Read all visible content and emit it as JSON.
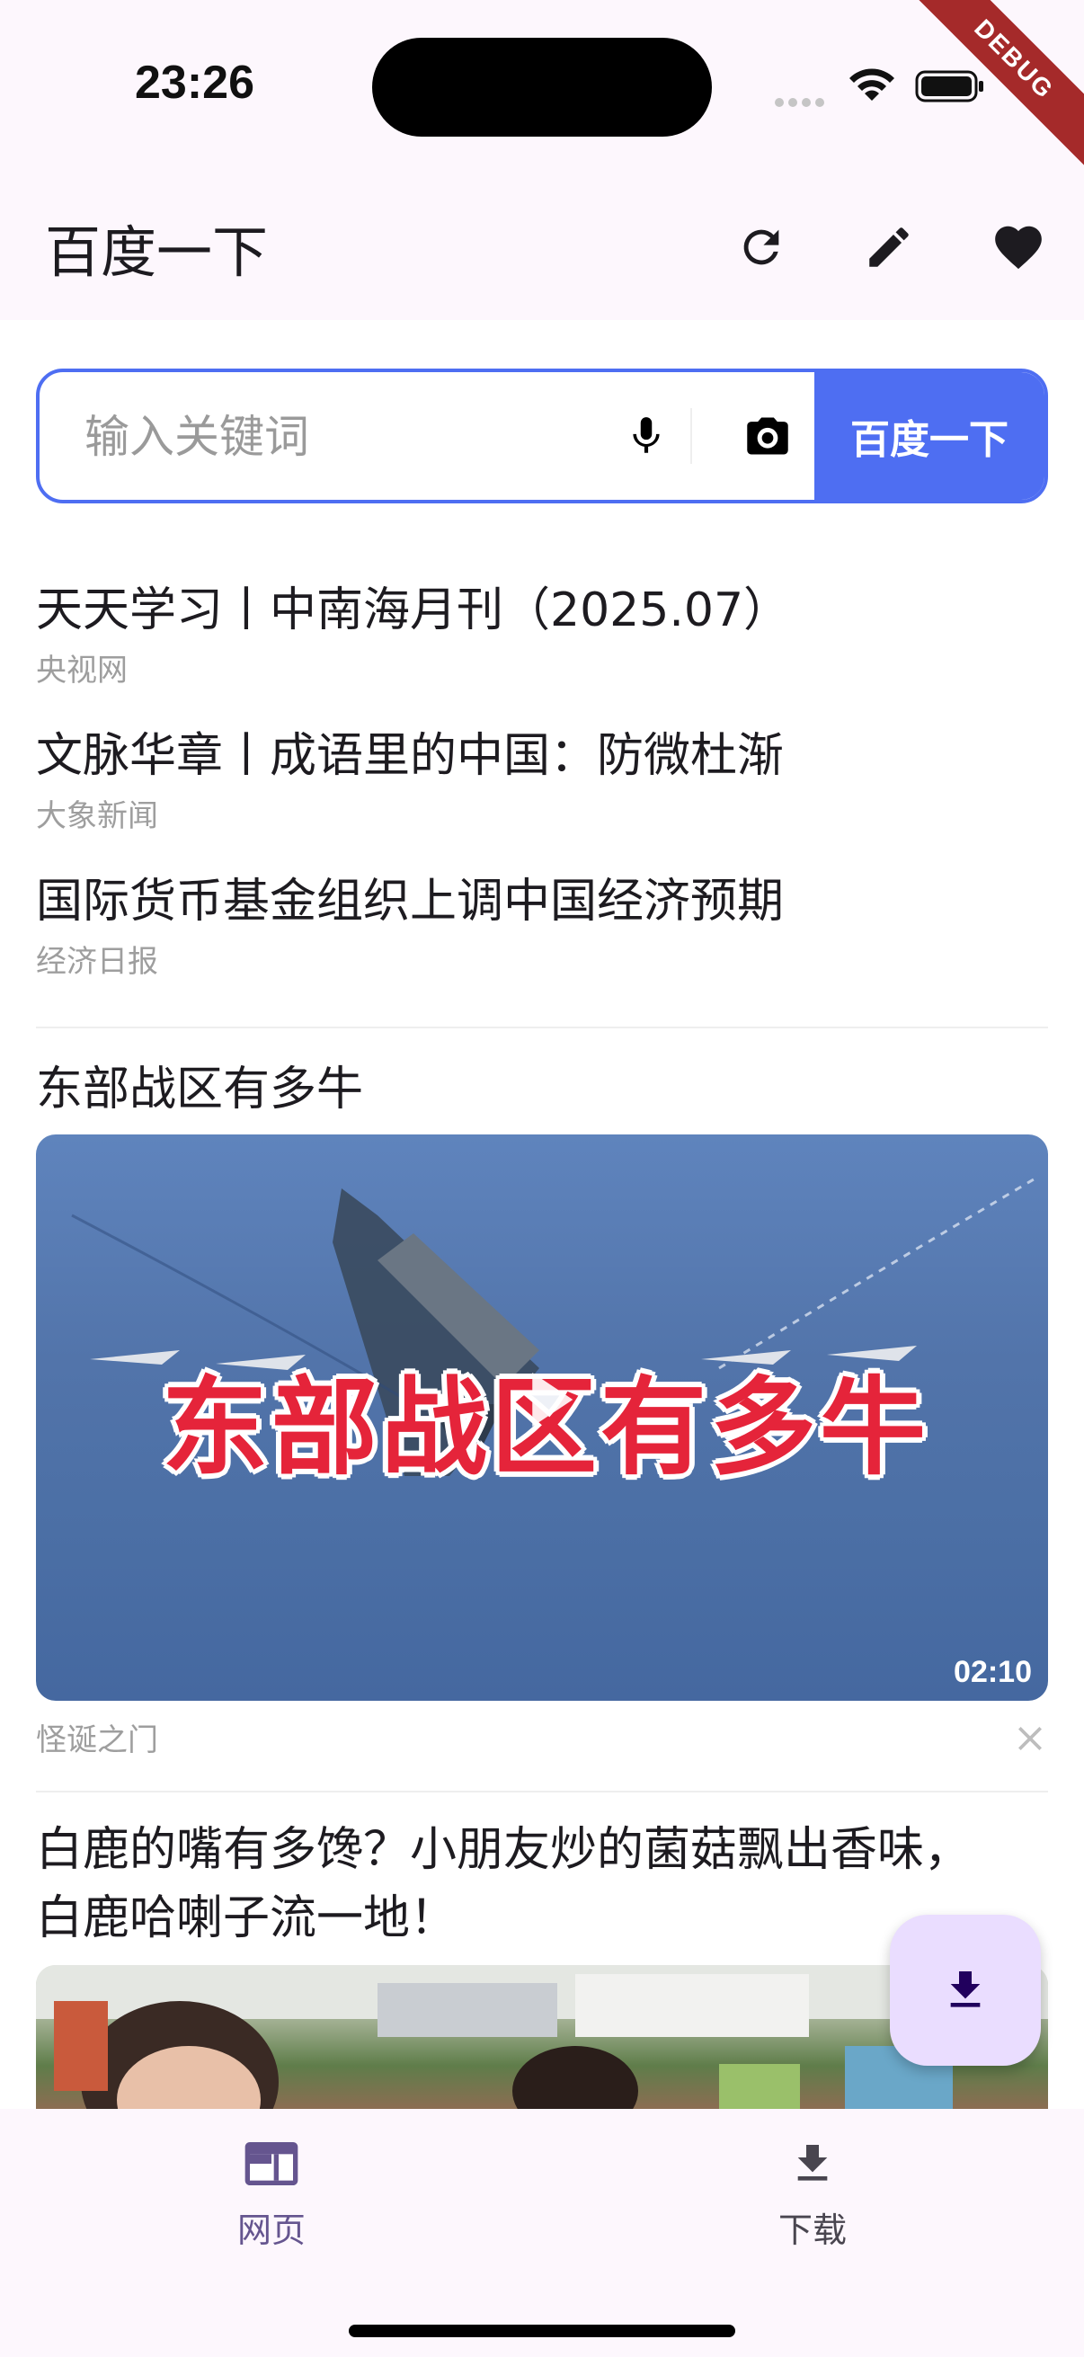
{
  "status_bar": {
    "time": "23:26",
    "debug_label": "DEBUG"
  },
  "app_bar": {
    "title": "百度一下",
    "icons": [
      "refresh-icon",
      "edit-icon",
      "favorite-icon"
    ]
  },
  "search": {
    "placeholder": "输入关键词",
    "button_label": "百度一下",
    "accent": "#4e6ef2"
  },
  "news": [
    {
      "title": "天天学习丨中南海月刊（2025.07）",
      "source": "央视网"
    },
    {
      "title": "文脉华章丨成语里的中国：防微杜渐",
      "source": "大象新闻"
    },
    {
      "title": "国际货币基金组织上调中国经济预期",
      "source": "经济日报"
    }
  ],
  "video_card": {
    "title": "东部战区有多牛",
    "overlay_text": "东部战区有多牛",
    "duration": "02:10",
    "source": "怪诞之门"
  },
  "card2": {
    "title": "白鹿的嘴有多馋？小朋友炒的菌菇飘出香味，白鹿哈喇子流一地！"
  },
  "bottom_nav": {
    "items": [
      {
        "label": "网页",
        "icon": "web-icon",
        "active": true
      },
      {
        "label": "下载",
        "icon": "download-icon",
        "active": false
      }
    ],
    "active_color": "#65558f",
    "inactive_color": "#49454f"
  }
}
